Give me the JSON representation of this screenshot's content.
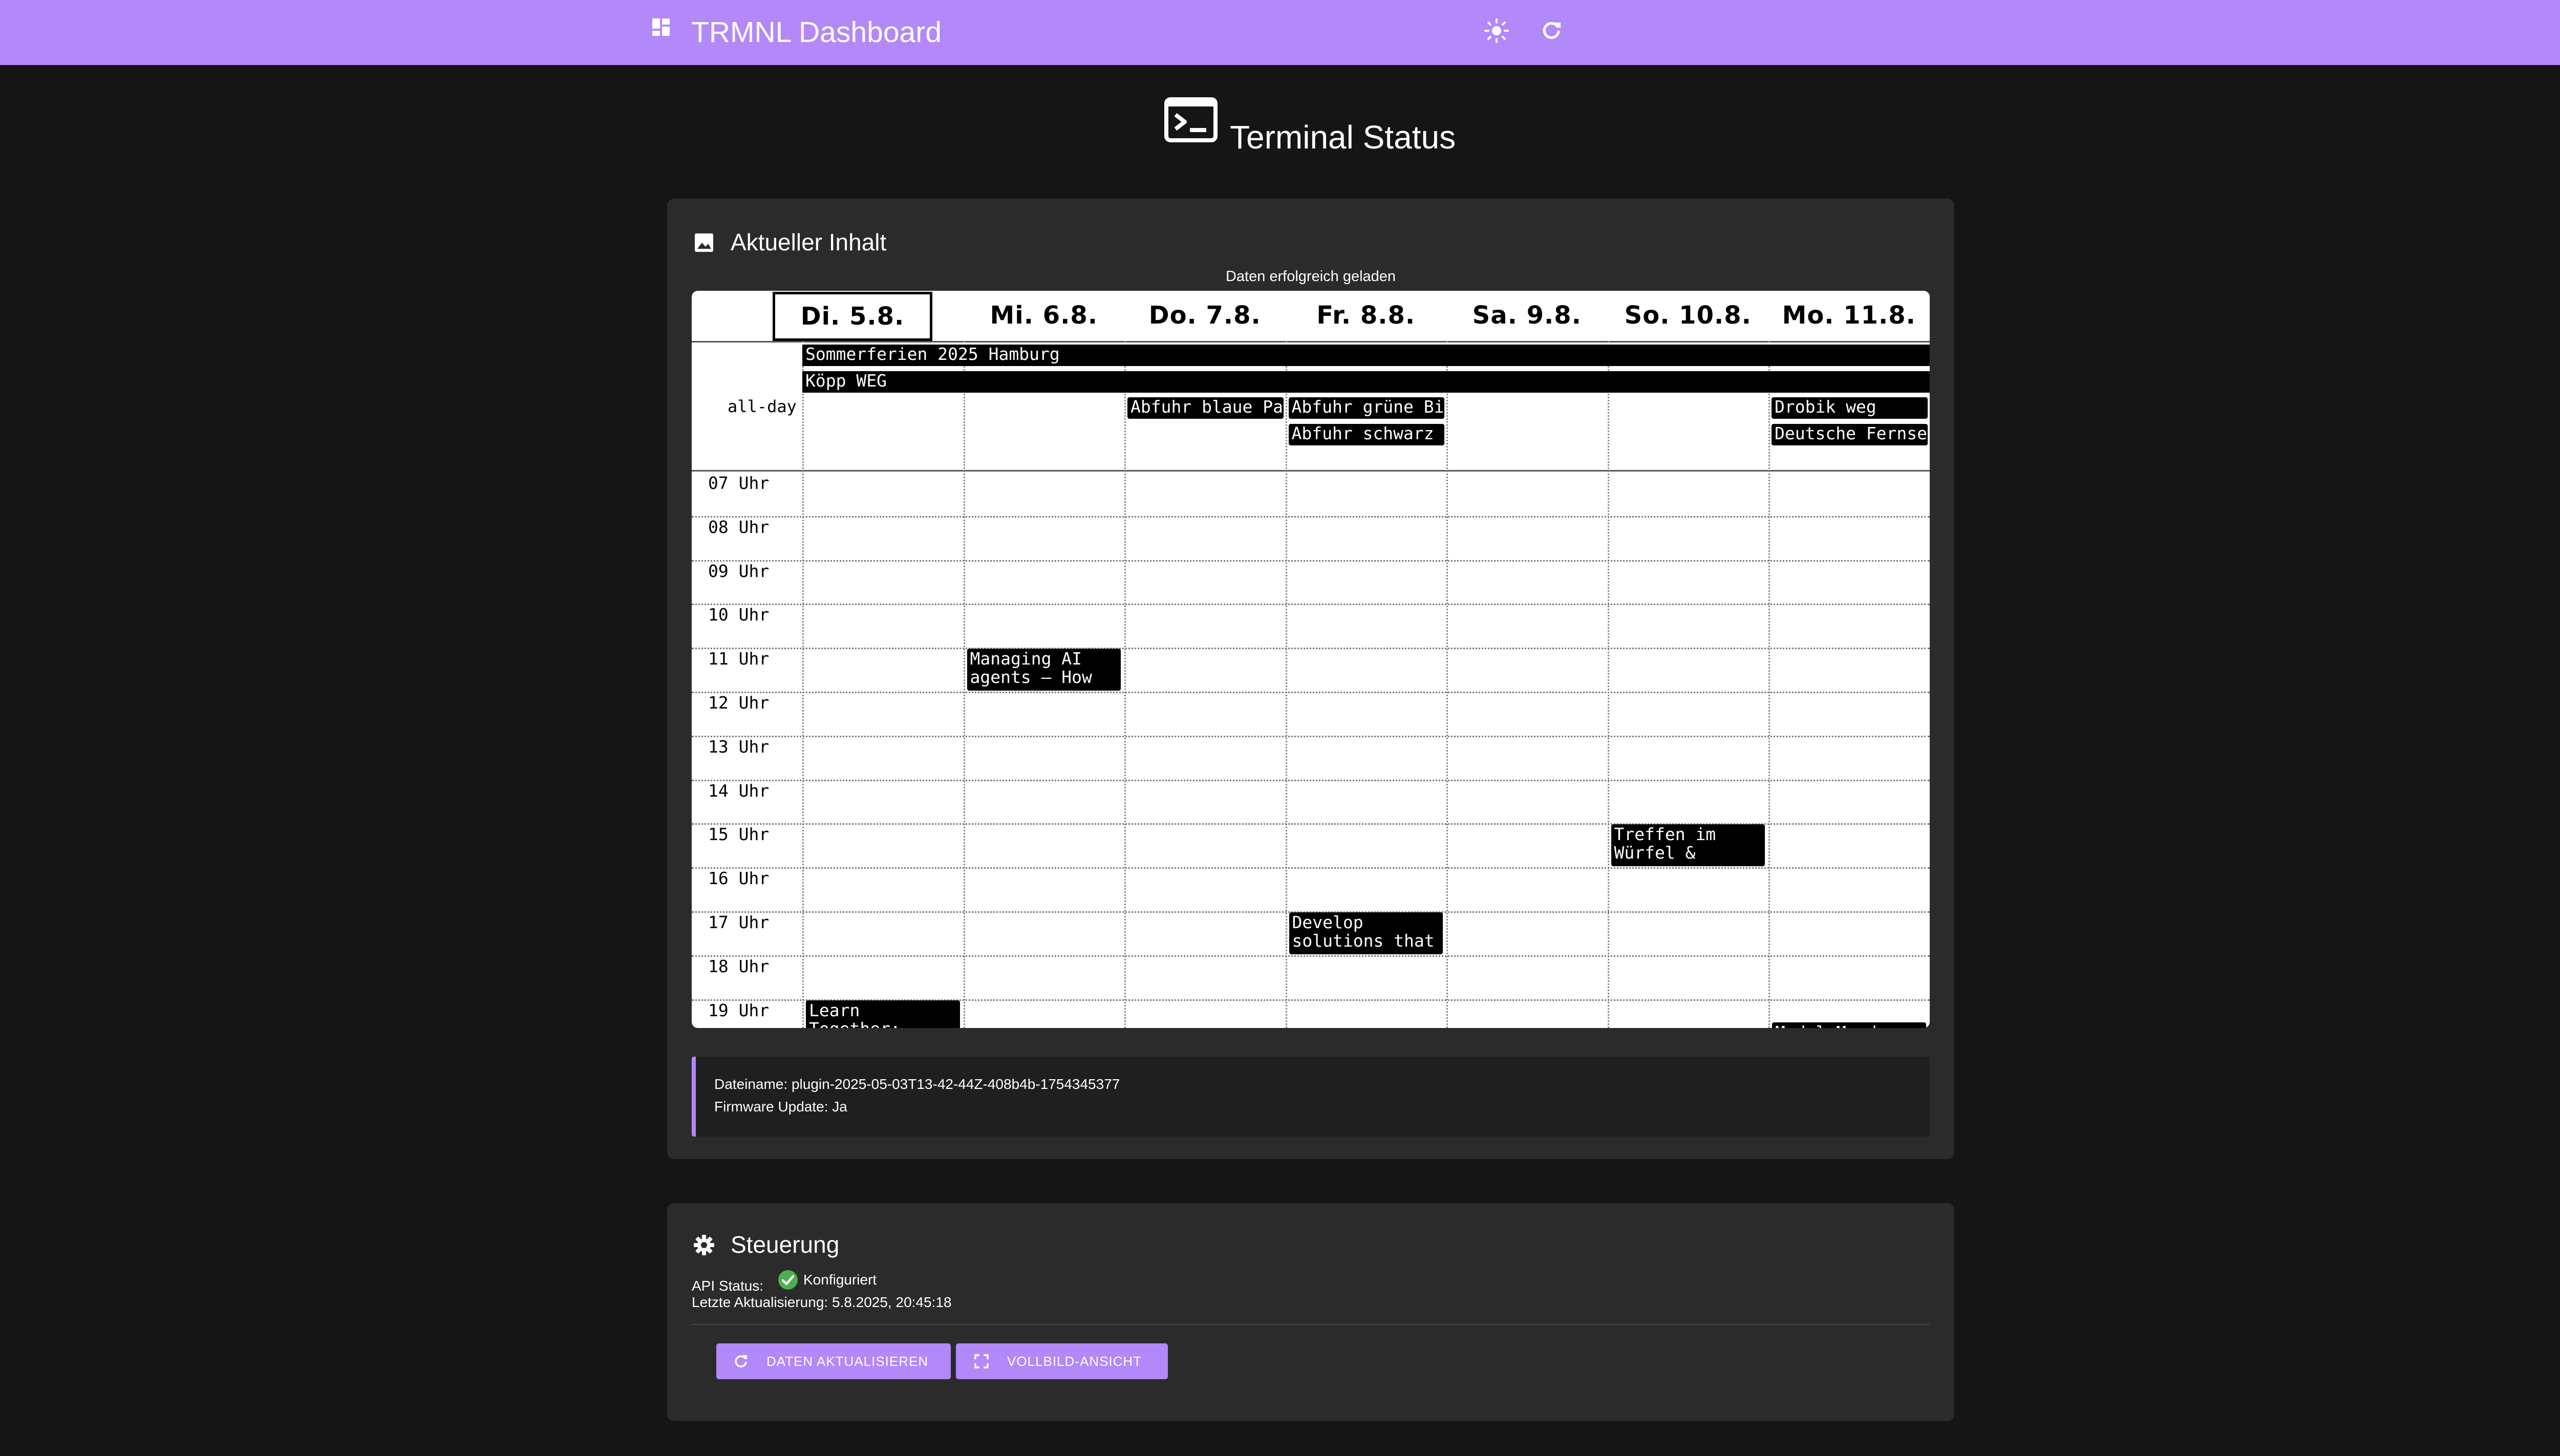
{
  "app": {
    "title": "TRMNL Dashboard",
    "accent_color": "#b388f9",
    "icons": {
      "logo": "dashboard-icon",
      "theme": "sun-icon",
      "refresh": "refresh-icon"
    }
  },
  "page": {
    "title": "Terminal Status",
    "icon": "terminal-icon"
  },
  "content_card": {
    "title": "Aktueller Inhalt",
    "icon": "image-icon",
    "load_status": "Daten erfolgreich geladen"
  },
  "calendar": {
    "days": [
      "Di. 5.8.",
      "Mi. 6.8.",
      "Do. 7.8.",
      "Fr. 8.8.",
      "Sa. 9.8.",
      "So. 10.8.",
      "Mo. 11.8."
    ],
    "today_index": 0,
    "allday_label": "all-day",
    "hours": [
      "07 Uhr",
      "08 Uhr",
      "09 Uhr",
      "10 Uhr",
      "11 Uhr",
      "12 Uhr",
      "13 Uhr",
      "14 Uhr",
      "15 Uhr",
      "16 Uhr",
      "17 Uhr",
      "18 Uhr",
      "19 Uhr"
    ],
    "allday_events": [
      {
        "title": "Sommerferien 2025 Hamburg",
        "day_start": 0,
        "day_span": 7,
        "row": 0
      },
      {
        "title": "Köpp WEG",
        "day_start": 0,
        "day_span": 7,
        "row": 1
      },
      {
        "title": "Abfuhr blaue Pa",
        "day_start": 2,
        "day_span": 1,
        "row": 2
      },
      {
        "title": "Abfuhr grüne Bi",
        "day_start": 3,
        "day_span": 1,
        "row": 2
      },
      {
        "title": "Abfuhr schwarz",
        "day_start": 3,
        "day_span": 1,
        "row": 3
      },
      {
        "title": "Drobik weg",
        "day_start": 6,
        "day_span": 1,
        "row": 2
      },
      {
        "title": "Deutsche Fernse",
        "day_start": 6,
        "day_span": 1,
        "row": 3
      }
    ],
    "timed_events": [
      {
        "title": "Managing AI agents – How",
        "day": 1,
        "hour_index": 4
      },
      {
        "title": "Treffen im Würfel &",
        "day": 5,
        "hour_index": 8
      },
      {
        "title": "Develop solutions that",
        "day": 3,
        "hour_index": 10
      },
      {
        "title": "Learn Together:",
        "day": 0,
        "hour_index": 12
      },
      {
        "title": "Model Mondays",
        "day": 6,
        "hour_index": 12.5
      }
    ]
  },
  "file_info": {
    "filename_line": "Dateiname: plugin-2025-05-03T13-42-44Z-408b4b-1754345377",
    "firmware_line": "Firmware Update: Ja"
  },
  "control_card": {
    "title": "Steuerung",
    "icon": "gear-icon",
    "api_label": "API Status:",
    "api_value": "Konfiguriert",
    "api_status_color": "#4caf50",
    "last_update": "Letzte Aktualisierung: 5.8.2025, 20:45:18",
    "buttons": {
      "refresh": "DATEN AKTUALISIEREN",
      "fullscreen": "VOLLBILD-ANSICHT"
    }
  }
}
